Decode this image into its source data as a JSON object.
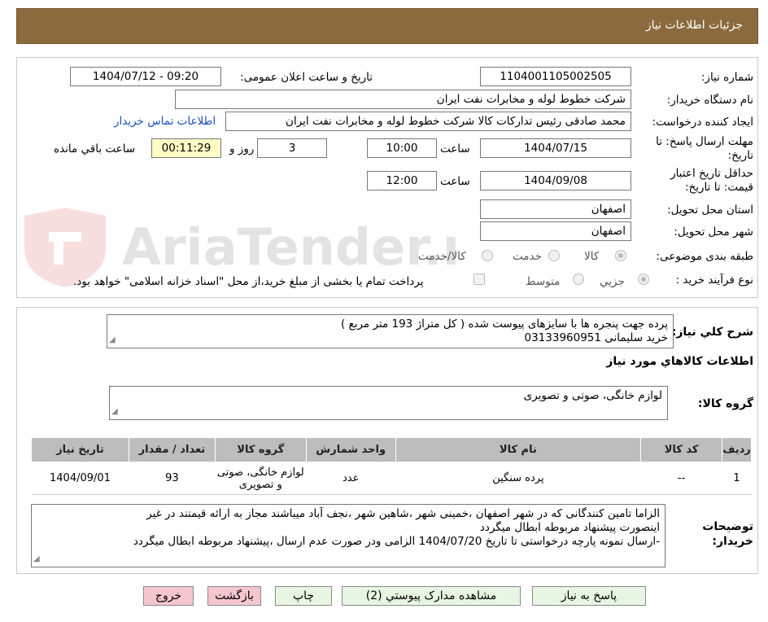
{
  "header": {
    "title": "جزئیات اطلاعات نیاز"
  },
  "form": {
    "need_number_label": "شماره نیاز:",
    "need_number": "1104001105002505",
    "announce_label": "تاریخ و ساعت اعلان عمومی:",
    "announce_value": "1404/07/12 - 09:20",
    "buyer_org_label": "نام دستگاه خریدار:",
    "buyer_org": "شرکت خطوط لوله و مخابرات نفت ایران",
    "requester_label": "ایجاد کننده درخواست:",
    "requester": "محمد صادقی رئیس تدارکات کالا  شرکت خطوط لوله و مخابرات نفت ایران",
    "contact_link": "اطلاعات تماس خریدار",
    "deadline_label": "مهلت ارسال پاسخ: تا تاریخ:",
    "deadline_date": "1404/07/15",
    "time_label": "ساعت",
    "deadline_time": "10:00",
    "days": "3",
    "days_label": "روز و",
    "remaining": "00:11:29",
    "remaining_label": "ساعت باقي مانده",
    "validity_label": "حداقل تاریخ اعتبار قیمت: تا تاریخ:",
    "validity_date": "1404/09/08",
    "validity_time": "12:00",
    "province_label": "استان محل تحویل:",
    "province": "اصفهان",
    "city_label": "شهر محل تحویل:",
    "city": "اصفهان",
    "category_label": "طبقه بندی موضوعی:",
    "cat_goods": "کالا",
    "cat_service": "خدمت",
    "cat_both": "کالا/خدمت",
    "process_label": "نوع فرآیند خرید :",
    "proc_small": "جزیي",
    "proc_medium": "متوسط",
    "payment_note": "پرداخت تمام یا بخشی از مبلغ خرید،از محل \"اسناد خزانه اسلامی\" خواهد بود."
  },
  "details": {
    "summary_label": "شرح کلي نياز:",
    "summary_line1": "پرده  جهت پنجره ها با سایزهای پیوست شده  (  کل متراژ 193 متر مربع )",
    "summary_line2": "خرید سلیمانی 03133960951",
    "items_heading": "اطلاعات کالاهاي مورد نياز",
    "group_label": "گروه کالا:",
    "group_value": "لوازم خانگی، صوتی و تصویری",
    "table": {
      "headers": [
        "رديف",
        "کد کالا",
        "نام کالا",
        "واحد شمارش",
        "گروه کالا",
        "تعداد / مقدار",
        "تاریخ نیاز"
      ],
      "rows": [
        {
          "row": "1",
          "code": "--",
          "name": "پرده سنگین",
          "unit": "عدد",
          "group": "لوازم خانگی، صوتی و تصویری",
          "qty": "93",
          "date": "1404/09/01"
        }
      ]
    },
    "notes_label": "توضیحات خریدار:",
    "notes_line1": "الزاما تامین کنندگانی که در شهر اصفهان ،خمینی شهر ،شاهین شهر ،نجف آباد میباشند مجاز به ارائه قیمتند  در غیر",
    "notes_line2": "اینصورت پیشنهاد مربوطه ابطال میگردد",
    "notes_line3": "-ارسال نمونه پارچه درخواستی تا تاریخ 1404/07/20 الزامی ودر صورت عدم ارسال ،پیشنهاد مربوطه ابطال میگردد"
  },
  "buttons": {
    "reply": "پاسخ به نیاز",
    "attachments": "مشاهده مدارک پیوستي (2)",
    "print": "چاپ",
    "back": "بازگشت",
    "exit": "خروج"
  },
  "watermark": {
    "text": "AriaTender.neT"
  }
}
